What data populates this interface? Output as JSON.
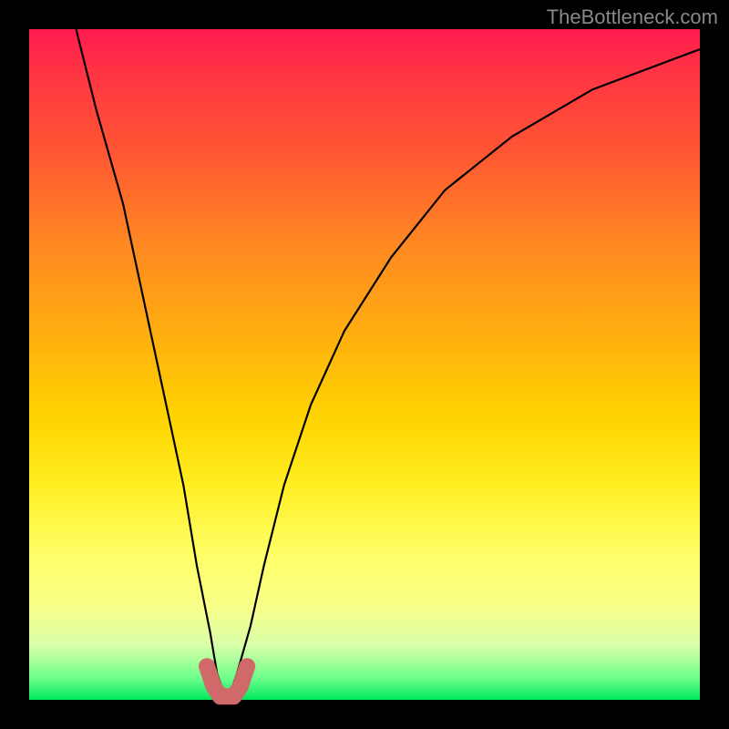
{
  "watermark": "TheBottleneck.com",
  "chart_data": {
    "type": "line",
    "title": "",
    "xlabel": "",
    "ylabel": "",
    "xlim": [
      0,
      100
    ],
    "ylim": [
      0,
      100
    ],
    "series": [
      {
        "name": "bottleneck-curve",
        "x": [
          7,
          10,
          14,
          17,
          20,
          23,
          25,
          27,
          28,
          29,
          30,
          31,
          33,
          35,
          38,
          42,
          47,
          54,
          62,
          72,
          84,
          100
        ],
        "y": [
          100,
          88,
          74,
          60,
          46,
          32,
          20,
          10,
          4,
          1,
          1,
          4,
          11,
          20,
          32,
          44,
          55,
          66,
          76,
          84,
          91,
          97
        ],
        "color": "#000000"
      },
      {
        "name": "highlight-bottom",
        "x": [
          26.5,
          27.5,
          28.5,
          29.5,
          30.5,
          31.5,
          32.5
        ],
        "y": [
          5,
          2,
          0.5,
          0.5,
          0.5,
          2,
          5
        ],
        "color": "#d06a6a"
      }
    ],
    "background_gradient": {
      "direction": "vertical",
      "stops": [
        {
          "pos": 0.0,
          "color": "#ff1a4d"
        },
        {
          "pos": 0.18,
          "color": "#ff5533"
        },
        {
          "pos": 0.44,
          "color": "#ffaa11"
        },
        {
          "pos": 0.68,
          "color": "#ffee22"
        },
        {
          "pos": 0.86,
          "color": "#f8ff88"
        },
        {
          "pos": 0.97,
          "color": "#66ff88"
        },
        {
          "pos": 1.0,
          "color": "#00e85c"
        }
      ]
    }
  }
}
